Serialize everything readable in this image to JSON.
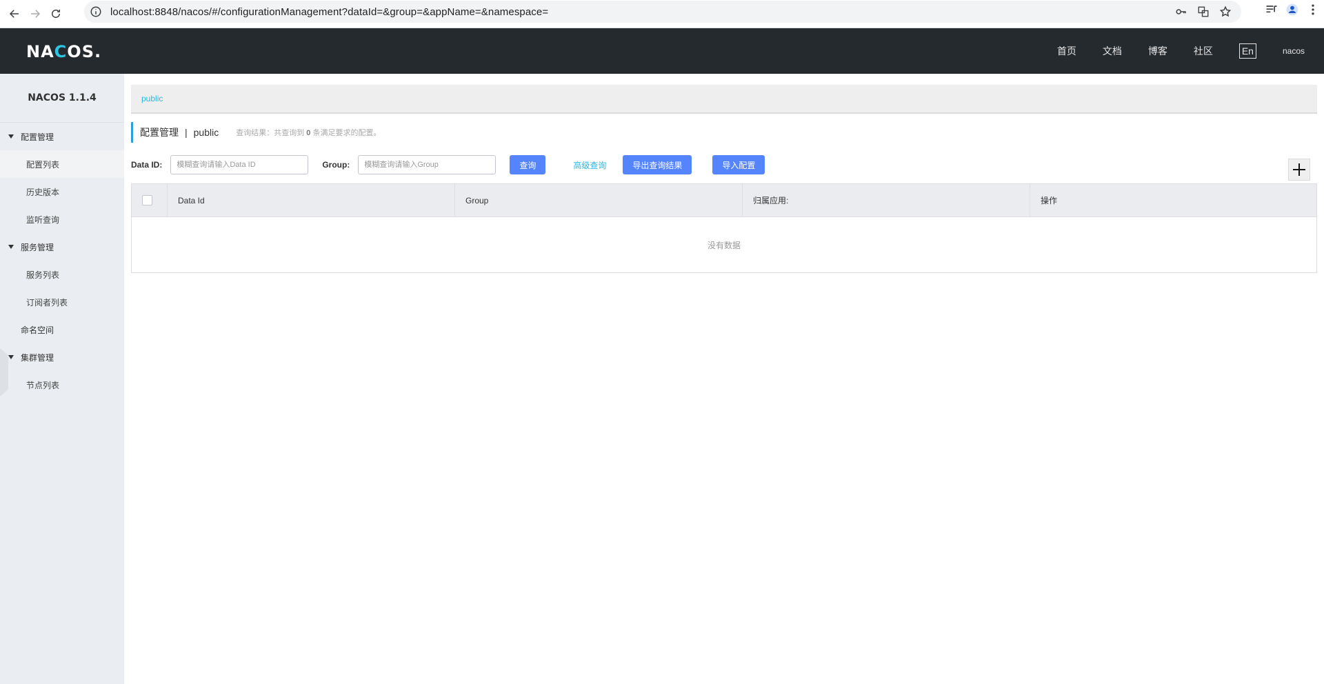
{
  "browser": {
    "url": "localhost:8848/nacos/#/configurationManagement?dataId=&group=&appName=&namespace="
  },
  "header": {
    "logo": "NACOS.",
    "nav": [
      "首页",
      "文档",
      "博客",
      "社区"
    ],
    "lang": "En",
    "user": "nacos"
  },
  "sidebar": {
    "title": "NACOS 1.1.4",
    "groups": [
      {
        "label": "配置管理",
        "items": [
          "配置列表",
          "历史版本",
          "监听查询"
        ]
      },
      {
        "label": "服务管理",
        "items": [
          "服务列表",
          "订阅者列表"
        ]
      }
    ],
    "namespace": "命名空间",
    "cluster": {
      "label": "集群管理",
      "items": [
        "节点列表"
      ]
    }
  },
  "main": {
    "breadcrumb": "public",
    "page_title": "配置管理",
    "separator": "|",
    "namespace": "public",
    "summary_prefix": "查询结果：共查询到",
    "summary_count": "0",
    "summary_suffix": "条满足要求的配置。",
    "filters": {
      "data_id_label": "Data ID:",
      "data_id_placeholder": "模糊查询请输入Data ID",
      "group_label": "Group:",
      "group_placeholder": "模糊查询请输入Group",
      "query_button": "查询",
      "advanced_query": "高级查询",
      "export_button": "导出查询结果",
      "import_button": "导入配置"
    },
    "table": {
      "columns": [
        "Data Id",
        "Group",
        "归属应用:",
        "操作"
      ],
      "empty_text": "没有数据"
    }
  }
}
